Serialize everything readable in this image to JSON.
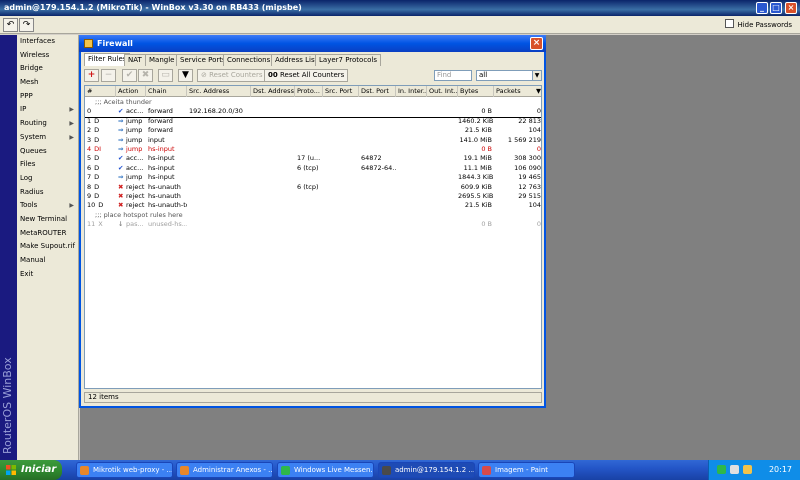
{
  "window": {
    "title": "admin@179.154.1.2 (MikroTik) - WinBox v3.30 on RB433 (mipsbe)",
    "hide_passwords_label": "Hide Passwords",
    "brand": "RouterOS WinBox"
  },
  "sidebar": {
    "items": [
      {
        "label": "Interfaces",
        "submenu": false
      },
      {
        "label": "Wireless",
        "submenu": false
      },
      {
        "label": "Bridge",
        "submenu": false
      },
      {
        "label": "Mesh",
        "submenu": false
      },
      {
        "label": "PPP",
        "submenu": false
      },
      {
        "label": "IP",
        "submenu": true
      },
      {
        "label": "Routing",
        "submenu": true
      },
      {
        "label": "System",
        "submenu": true
      },
      {
        "label": "Queues",
        "submenu": false
      },
      {
        "label": "Files",
        "submenu": false
      },
      {
        "label": "Log",
        "submenu": false
      },
      {
        "label": "Radius",
        "submenu": false
      },
      {
        "label": "Tools",
        "submenu": true
      },
      {
        "label": "New Terminal",
        "submenu": false
      },
      {
        "label": "MetaROUTER",
        "submenu": false
      },
      {
        "label": "Make Supout.rif",
        "submenu": false
      },
      {
        "label": "Manual",
        "submenu": false
      },
      {
        "label": "Exit",
        "submenu": false
      }
    ]
  },
  "firewall": {
    "title": "Firewall",
    "tabs": [
      "Filter Rules",
      "NAT",
      "Mangle",
      "Service Ports",
      "Connections",
      "Address Lists",
      "Layer7 Protocols"
    ],
    "active_tab": "Filter Rules",
    "toolbar": {
      "reset_counters": "Reset Counters",
      "reset_all_counters": "Reset All Counters",
      "reset_all_prefix": "00",
      "find_placeholder": "Find",
      "filter_value": "all"
    },
    "columns": [
      "#",
      "Action",
      "Chain",
      "Src. Address",
      "Dst. Address",
      "Proto...",
      "Src. Port",
      "Dst. Port",
      "In. Inter...",
      "Out. Int...",
      "Bytes",
      "Packets"
    ],
    "rows": [
      {
        "type": "comment",
        "text": ";;; Aceita thunder"
      },
      {
        "num": "0",
        "flag": "",
        "action": "acc...",
        "action_kind": "accept",
        "chain": "forward",
        "src": "192.168.20.0/30",
        "dst": "",
        "proto": "",
        "sport": "",
        "dport": "",
        "in": "",
        "out": "",
        "bytes": "0 B",
        "packets": "0"
      },
      {
        "num": "1",
        "flag": "D",
        "action": "jump",
        "action_kind": "jump",
        "chain": "forward",
        "src": "",
        "dst": "",
        "proto": "",
        "sport": "",
        "dport": "",
        "in": "",
        "out": "",
        "bytes": "1460.2 KiB",
        "packets": "22 813"
      },
      {
        "num": "2",
        "flag": "D",
        "action": "jump",
        "action_kind": "jump",
        "chain": "forward",
        "src": "",
        "dst": "",
        "proto": "",
        "sport": "",
        "dport": "",
        "in": "",
        "out": "",
        "bytes": "21.5 KiB",
        "packets": "104"
      },
      {
        "num": "3",
        "flag": "D",
        "action": "jump",
        "action_kind": "jump",
        "chain": "input",
        "src": "",
        "dst": "",
        "proto": "",
        "sport": "",
        "dport": "",
        "in": "",
        "out": "",
        "bytes": "141.0 MiB",
        "packets": "1 569 219"
      },
      {
        "num": "4",
        "flag": "DI",
        "action": "jump",
        "action_kind": "jump",
        "chain": "hs-input",
        "src": "",
        "dst": "",
        "proto": "",
        "sport": "",
        "dport": "",
        "in": "",
        "out": "",
        "bytes": "0 B",
        "packets": "0",
        "state": "disabled"
      },
      {
        "num": "5",
        "flag": "D",
        "action": "acc...",
        "action_kind": "accept",
        "chain": "hs-input",
        "src": "",
        "dst": "",
        "proto": "17 (u...",
        "sport": "",
        "dport": "64872",
        "in": "",
        "out": "",
        "bytes": "19.1 MiB",
        "packets": "308 300"
      },
      {
        "num": "6",
        "flag": "D",
        "action": "acc...",
        "action_kind": "accept",
        "chain": "hs-input",
        "src": "",
        "dst": "",
        "proto": "6 (tcp)",
        "sport": "",
        "dport": "64872-64...",
        "in": "",
        "out": "",
        "bytes": "11.1 MiB",
        "packets": "106 090"
      },
      {
        "num": "7",
        "flag": "D",
        "action": "jump",
        "action_kind": "jump",
        "chain": "hs-input",
        "src": "",
        "dst": "",
        "proto": "",
        "sport": "",
        "dport": "",
        "in": "",
        "out": "",
        "bytes": "1844.3 KiB",
        "packets": "19 465"
      },
      {
        "num": "8",
        "flag": "D",
        "action": "reject",
        "action_kind": "reject",
        "chain": "hs-unauth",
        "src": "",
        "dst": "",
        "proto": "6 (tcp)",
        "sport": "",
        "dport": "",
        "in": "",
        "out": "",
        "bytes": "609.9 KiB",
        "packets": "12 763"
      },
      {
        "num": "9",
        "flag": "D",
        "action": "reject",
        "action_kind": "reject",
        "chain": "hs-unauth",
        "src": "",
        "dst": "",
        "proto": "",
        "sport": "",
        "dport": "",
        "in": "",
        "out": "",
        "bytes": "2695.5 KiB",
        "packets": "29 515"
      },
      {
        "num": "10",
        "flag": "D",
        "action": "reject",
        "action_kind": "reject",
        "chain": "hs-unauth-to",
        "src": "",
        "dst": "",
        "proto": "",
        "sport": "",
        "dport": "",
        "in": "",
        "out": "",
        "bytes": "21.5 KiB",
        "packets": "104"
      },
      {
        "type": "comment",
        "text": ";;; place hotspot rules here",
        "state": "inactive"
      },
      {
        "num": "11",
        "flag": "X",
        "action": "pas...",
        "action_kind": "passthrough",
        "chain": "unused-hs...",
        "src": "",
        "dst": "",
        "proto": "",
        "sport": "",
        "dport": "",
        "in": "",
        "out": "",
        "bytes": "0 B",
        "packets": "0",
        "state": "inactive"
      }
    ],
    "status": "12 items"
  },
  "taskbar": {
    "start_label": "Iniciar",
    "tasks": [
      {
        "label": "Mikrotik web-proxy - ...",
        "color": "#e8872a"
      },
      {
        "label": "Administrar Anexos - ...",
        "color": "#e8872a"
      },
      {
        "label": "Windows Live Messen...",
        "color": "#2eb84a"
      },
      {
        "label": "admin@179.154.1.2 ...",
        "color": "#4a4a4a",
        "active": true
      },
      {
        "label": "Imagem - Paint",
        "color": "#d84a4a"
      }
    ],
    "clock": "20:17"
  },
  "colors": {
    "accent": "#0054e3",
    "disabled_row": "#cc0000",
    "inactive_row": "#a0a0a0"
  }
}
